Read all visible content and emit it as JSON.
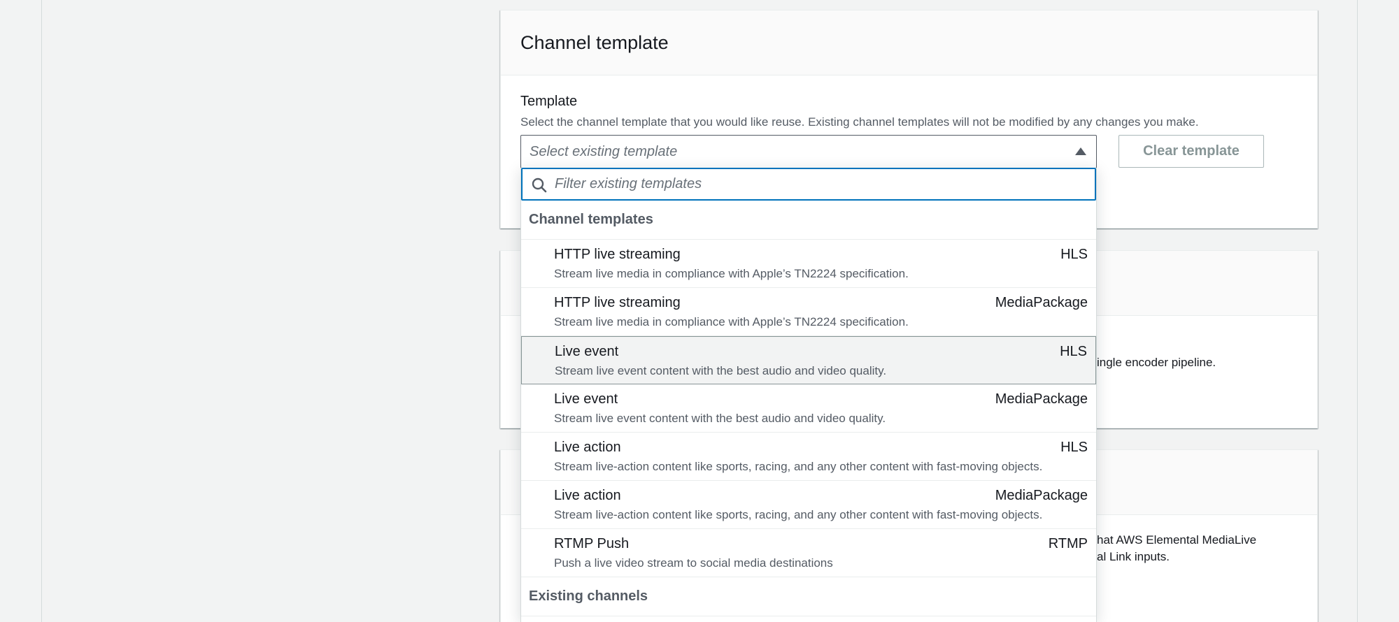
{
  "card1": {
    "title": "Channel template",
    "field_label": "Template",
    "field_desc": "Select the channel template that you would like reuse. Existing channel templates will not be modified by any changes you make.",
    "select_placeholder": "Select existing template",
    "clear_button": "Clear template"
  },
  "background_text": {
    "card2_partial": "ingle encoder pipeline.",
    "card3_line1": "hat AWS Elemental MediaLive",
    "card3_line2": "al Link inputs."
  },
  "dropdown": {
    "filter_placeholder": "Filter existing templates",
    "groups": [
      {
        "label": "Channel templates",
        "options": [
          {
            "label": "HTTP live streaming",
            "tag": "HLS",
            "desc": "Stream live media in compliance with Apple’s TN2224 specification."
          },
          {
            "label": "HTTP live streaming",
            "tag": "MediaPackage",
            "desc": "Stream live media in compliance with Apple’s TN2224 specification."
          },
          {
            "label": "Live event",
            "tag": "HLS",
            "desc": "Stream live event content with the best audio and video quality."
          },
          {
            "label": "Live event",
            "tag": "MediaPackage",
            "desc": "Stream live event content with the best audio and video quality."
          },
          {
            "label": "Live action",
            "tag": "HLS",
            "desc": "Stream live-action content like sports, racing, and any other content with fast-moving objects."
          },
          {
            "label": "Live action",
            "tag": "MediaPackage",
            "desc": "Stream live-action content like sports, racing, and any other content with fast-moving objects."
          },
          {
            "label": "RTMP Push",
            "tag": "RTMP",
            "desc": "Push a live video stream to social media destinations"
          }
        ]
      },
      {
        "label": "Existing channels",
        "options": []
      }
    ]
  },
  "colors": {
    "accent_focus": "#0073bb",
    "text_primary": "#16191f",
    "text_secondary": "#545b64",
    "page_bg": "#f2f3f3"
  }
}
